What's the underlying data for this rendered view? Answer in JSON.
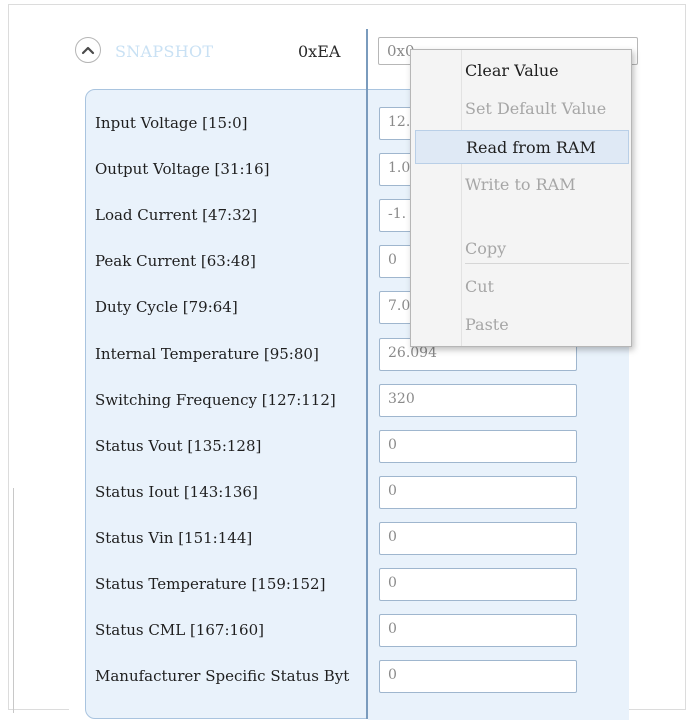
{
  "section": {
    "title": "SNAPSHOT",
    "address": "0xEA",
    "value": "0x0"
  },
  "fields": [
    {
      "label": "Input Voltage [15:0]",
      "value": "12."
    },
    {
      "label": "Output Voltage [31:16]",
      "value": "1.0"
    },
    {
      "label": "Load Current [47:32]",
      "value": "-1."
    },
    {
      "label": "Peak Current [63:48]",
      "value": "0"
    },
    {
      "label": "Duty Cycle [79:64]",
      "value": "7.0"
    },
    {
      "label": "Internal Temperature [95:80]",
      "value": "26.094"
    },
    {
      "label": "Switching Frequency [127:112]",
      "value": "320"
    },
    {
      "label": "Status Vout [135:128]",
      "value": "0"
    },
    {
      "label": "Status Iout [143:136]",
      "value": "0"
    },
    {
      "label": "Status Vin [151:144]",
      "value": "0"
    },
    {
      "label": "Status Temperature [159:152]",
      "value": "0"
    },
    {
      "label": "Status CML [167:160]",
      "value": "0"
    },
    {
      "label": "Manufacturer Specific Status Byt",
      "value": "0"
    }
  ],
  "context_menu": {
    "items": [
      {
        "label": "Clear Value",
        "enabled": true
      },
      {
        "label": "Set Default Value",
        "enabled": false
      },
      {
        "label": "Read from RAM",
        "enabled": true,
        "hover": true
      },
      {
        "label": "Write to RAM",
        "enabled": false
      },
      {
        "label": "Copy",
        "enabled": false
      },
      {
        "label": "Cut",
        "enabled": false
      },
      {
        "label": "Paste",
        "enabled": false
      }
    ]
  },
  "colors": {
    "accent": "#7a9bbd",
    "group_fill": "#e9f2fb",
    "title_text": "#c9e1f4",
    "menu_hover": "#dfe9f5"
  },
  "icons": {
    "collapse": "chevron-up-icon"
  }
}
